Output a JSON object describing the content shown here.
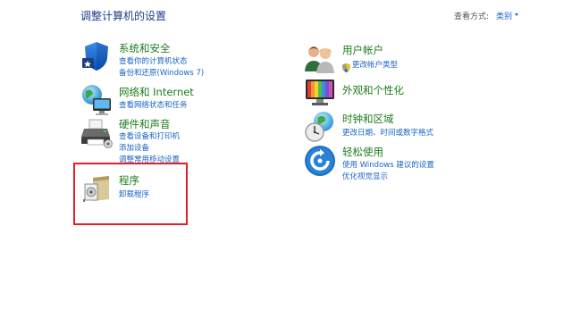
{
  "header": {
    "title": "调整计算机的设置",
    "view_by_label": "查看方式:",
    "view_by_value": "类别"
  },
  "categories": {
    "system_security": {
      "title": "系统和安全",
      "links": [
        "查看你的计算机状态",
        "备份和还原(Windows 7)"
      ],
      "icon": "shield-icon"
    },
    "network_internet": {
      "title": "网络和 Internet",
      "links": [
        "查看网络状态和任务"
      ],
      "icon": "network-globe-icon"
    },
    "hardware_sound": {
      "title": "硬件和声音",
      "links": [
        "查看设备和打印机",
        "添加设备",
        "调整常用移动设置"
      ],
      "icon": "printer-icon"
    },
    "programs": {
      "title": "程序",
      "links": [
        "卸载程序"
      ],
      "icon": "programs-disc-icon"
    },
    "user_accounts": {
      "title": "用户帐户",
      "links": [
        "更改帐户类型"
      ],
      "icon": "users-icon"
    },
    "appearance": {
      "title": "外观和个性化",
      "links": [],
      "icon": "monitor-palette-icon"
    },
    "clock_region": {
      "title": "时钟和区域",
      "links": [
        "更改日期、时间或数字格式"
      ],
      "icon": "clock-globe-icon"
    },
    "ease_of_access": {
      "title": "轻松使用",
      "links": [
        "使用 Windows 建议的设置",
        "优化视觉显示"
      ],
      "icon": "ease-of-access-icon"
    }
  },
  "colors": {
    "category_title": "#1e7c1e",
    "link": "#1a63c6",
    "highlight": "#e0202a"
  }
}
